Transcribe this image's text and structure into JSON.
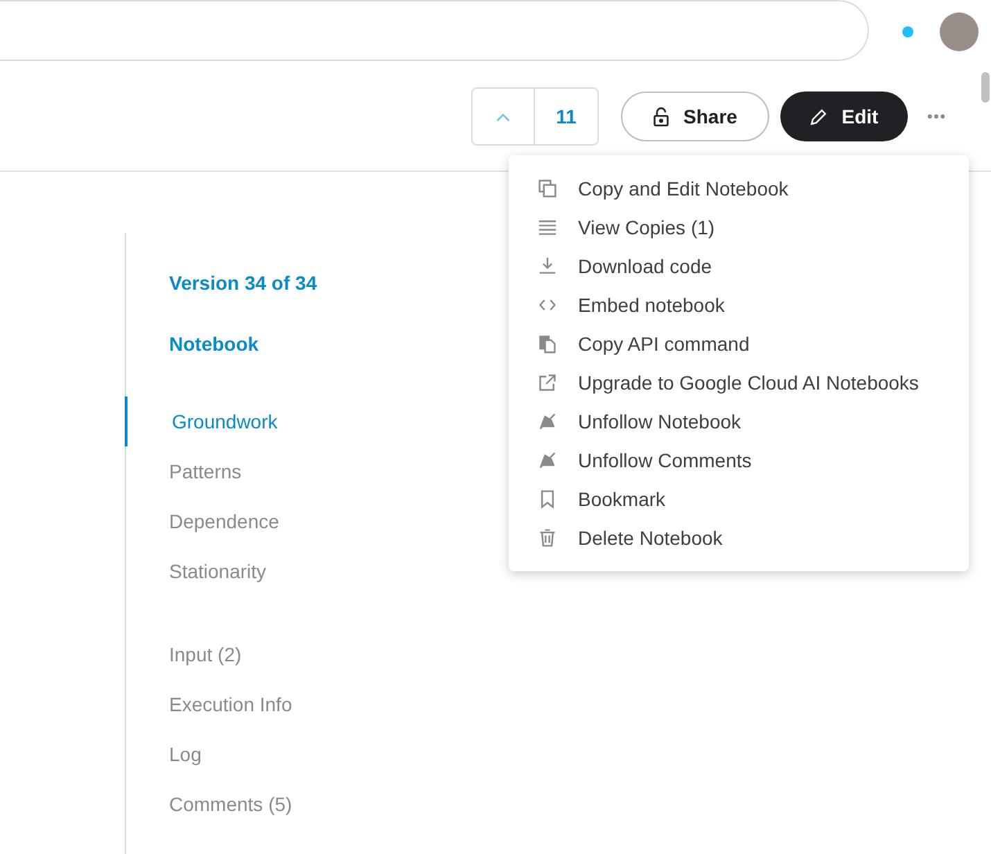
{
  "header": {
    "notification_dot": {
      "color": "#20beff"
    }
  },
  "toolbar": {
    "vote_count": "11",
    "share": "Share",
    "edit": "Edit"
  },
  "menu": {
    "items": [
      {
        "kind": "copy",
        "label": "Copy and Edit Notebook"
      },
      {
        "kind": "list",
        "label": "View Copies (1)"
      },
      {
        "kind": "download",
        "label": "Download code"
      },
      {
        "kind": "code",
        "label": "Embed notebook"
      },
      {
        "kind": "clipboard",
        "label": "Copy API command"
      },
      {
        "kind": "external",
        "label": "Upgrade to Google Cloud AI Notebooks"
      },
      {
        "kind": "unfollow",
        "label": "Unfollow Notebook"
      },
      {
        "kind": "unfollow",
        "label": "Unfollow Comments"
      },
      {
        "kind": "bookmark",
        "label": "Bookmark"
      },
      {
        "kind": "trash",
        "label": "Delete Notebook"
      }
    ]
  },
  "sidebar": {
    "version": "Version 34 of 34",
    "notebook": "Notebook",
    "toc": [
      {
        "label": "Groundwork",
        "selected": true
      },
      {
        "label": "Patterns",
        "selected": false
      },
      {
        "label": "Dependence",
        "selected": false
      },
      {
        "label": "Stationarity",
        "selected": false
      }
    ],
    "links": [
      "Input (2)",
      "Execution Info",
      "Log",
      "Comments (5)"
    ]
  }
}
